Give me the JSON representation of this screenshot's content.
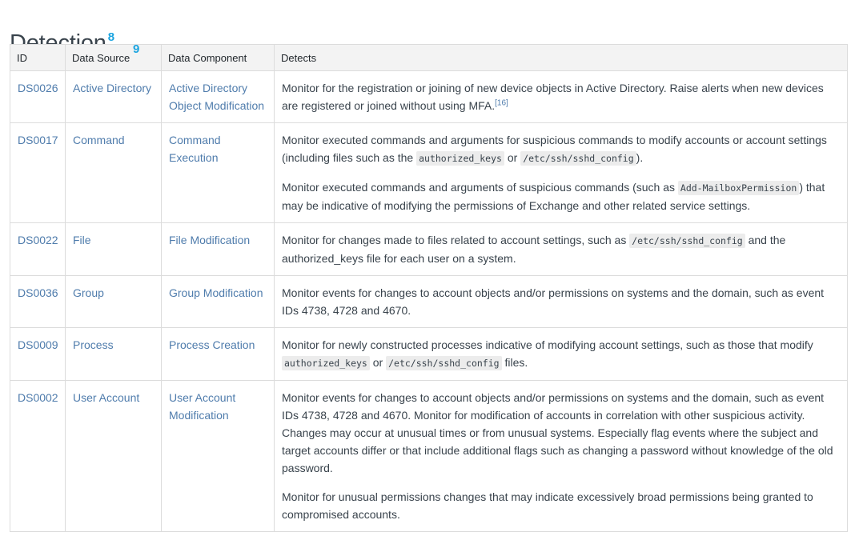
{
  "section": {
    "title": "Detection",
    "title_sup": "8"
  },
  "table": {
    "headers": {
      "id": "ID",
      "data_source": "Data Source",
      "data_source_sup": "9",
      "data_component": "Data Component",
      "detects": "Detects"
    },
    "rows": [
      {
        "id": "DS0026",
        "source": "Active Directory",
        "component": "Active Directory Object Modification",
        "p1_a": "Monitor for the registration or joining of new device objects in Active Directory. Raise alerts when new devices are registered or joined without using MFA.",
        "p1_ref": "[16]"
      },
      {
        "id": "DS0017",
        "source": "Command",
        "component": "Command Execution",
        "p1_a": "Monitor executed commands and arguments for suspicious commands to modify accounts or account settings (including files such as the ",
        "p1_code1": "authorized_keys",
        "p1_b": " or ",
        "p1_code2": "/etc/ssh/sshd_config",
        "p1_c": ").",
        "p2_a": "Monitor executed commands and arguments of suspicious commands (such as ",
        "p2_code1": "Add-MailboxPermission",
        "p2_b": ") that may be indicative of modifying the permissions of Exchange and other related service settings."
      },
      {
        "id": "DS0022",
        "source": "File",
        "component": "File Modification",
        "p1_a": "Monitor for changes made to files related to account settings, such as ",
        "p1_code1": "/etc/ssh/sshd_config",
        "p1_b": " and the authorized_keys file for each user on a system."
      },
      {
        "id": "DS0036",
        "source": "Group",
        "component": "Group Modification",
        "p1_a": "Monitor events for changes to account objects and/or permissions on systems and the domain, such as event IDs 4738, 4728 and 4670."
      },
      {
        "id": "DS0009",
        "source": "Process",
        "component": "Process Creation",
        "p1_a": "Monitor for newly constructed processes indicative of modifying account settings, such as those that modify ",
        "p1_code1": "authorized_keys",
        "p1_b": " or ",
        "p1_code2": "/etc/ssh/sshd_config",
        "p1_c": " files."
      },
      {
        "id": "DS0002",
        "source": "User Account",
        "component": "User Account Modification",
        "p1_a": "Monitor events for changes to account objects and/or permissions on systems and the domain, such as event IDs 4738, 4728 and 4670. Monitor for modification of accounts in correlation with other suspicious activity. Changes may occur at unusual times or from unusual systems. Especially flag events where the subject and target accounts differ or that include additional flags such as changing a password without knowledge of the old password.",
        "p2_a": "Monitor for unusual permissions changes that may indicate excessively broad permissions being granted to compromised accounts."
      }
    ]
  }
}
